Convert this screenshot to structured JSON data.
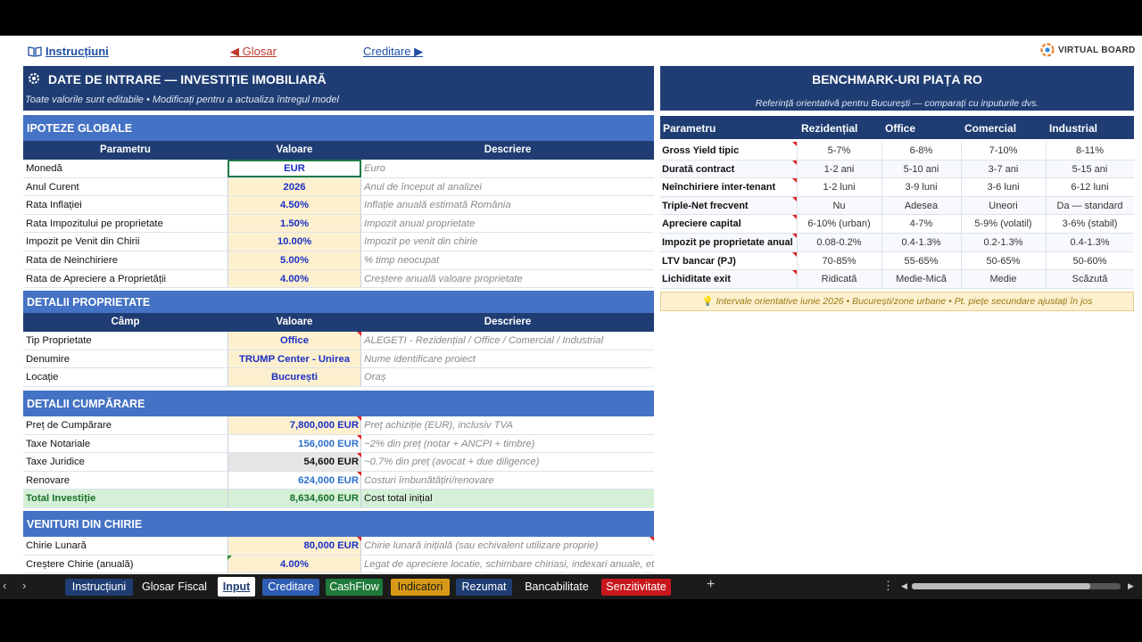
{
  "nav": {
    "instructions": "Instrucțiuni",
    "back": "◀ Glosar",
    "forward": "Creditare ▶",
    "logo": "VIRTUAL BOARD",
    "book_icon": "book-icon"
  },
  "input_header": {
    "title": "DATE DE INTRARE — INVESTIȚIE IMOBILIARĂ",
    "subtitle": "Toate valorile sunt editabile  •  Modificați pentru a actualiza întregul model",
    "icon": "gear-icon"
  },
  "benchmark_header": {
    "title": "BENCHMARK-URI PIAȚA RO",
    "subtitle": "Referință orientativă pentru București — comparați cu inputurile dvs."
  },
  "global": {
    "title": "IPOTEZE GLOBALE",
    "cols": [
      "Parametru",
      "Valoare",
      "Descriere"
    ],
    "rows": [
      {
        "label": "Monedă",
        "value": "EUR",
        "desc": "Euro"
      },
      {
        "label": "Anul Curent",
        "value": "2026",
        "desc": "Anul de început al analizei"
      },
      {
        "label": "Rata Inflației",
        "value": "4.50%",
        "desc": "Inflație anuală estimată România"
      },
      {
        "label": "Rata Impozitului pe proprietate",
        "value": "1.50%",
        "desc": "Impozit anual proprietate"
      },
      {
        "label": "Impozit pe Venit din Chirii",
        "value": "10.00%",
        "desc": "Impozit pe venit din chirie"
      },
      {
        "label": "Rata de Neinchiriere",
        "value": "5.00%",
        "desc": "% timp neocupat"
      },
      {
        "label": "Rata de Apreciere a Proprietății",
        "value": "4.00%",
        "desc": "Creștere anuală valoare proprietate"
      }
    ]
  },
  "property": {
    "title": "DETALII PROPRIETATE",
    "cols": [
      "Câmp",
      "Valoare",
      "Descriere"
    ],
    "rows": [
      {
        "label": "Tip Proprietate",
        "value": "Office",
        "desc": "ALEGETI - Rezidențial / Office / Comercial / Industrial"
      },
      {
        "label": "Denumire",
        "value": "TRUMP Center - Unirea",
        "desc": "Nume identificare proiect"
      },
      {
        "label": "Locație",
        "value": "București",
        "desc": "Oraș"
      }
    ]
  },
  "purchase": {
    "title": "DETALII CUMPĂRARE",
    "rows": [
      {
        "label": "Preț de Cumpărare",
        "value": "7,800,000 EUR",
        "desc": "Preț achiziție (EUR), inclusiv TVA"
      },
      {
        "label": "Taxe Notariale",
        "value": "156,000 EUR",
        "desc": "~2% din preț (notar + ANCPI + timbre)"
      },
      {
        "label": "Taxe Juridice",
        "value": "54,600 EUR",
        "desc": "~0.7% din preț (avocat + due diligence)"
      },
      {
        "label": "Renovare",
        "value": "624,000 EUR",
        "desc": "Costuri îmbunătățiri/renovare"
      }
    ],
    "total": {
      "label": "Total Investiție",
      "value": "8,634,600 EUR",
      "desc": "Cost total inițial"
    }
  },
  "rent": {
    "title": "VENITURI DIN CHIRIE",
    "rows": [
      {
        "label": "Chirie Lunară",
        "value": "80,000 EUR",
        "desc": "Chirie lunară inițială (sau echivalent utilizare proprie)"
      },
      {
        "label": "Creștere Chirie (anuală)",
        "value": "4.00%",
        "desc": "Legat de apreciere locatie, schimbare chiriasi, indexari anuale, etc"
      }
    ]
  },
  "benchmark": {
    "cols": [
      "Parametru",
      "Rezidențial",
      "Office",
      "Comercial",
      "Industrial"
    ],
    "rows": [
      [
        "Gross Yield tipic",
        "5-7%",
        "6-8%",
        "7-10%",
        "8-11%"
      ],
      [
        "Durată contract",
        "1-2 ani",
        "5-10 ani",
        "3-7 ani",
        "5-15 ani"
      ],
      [
        "Neînchiriere inter-tenant",
        "1-2 luni",
        "3-9 luni",
        "3-6 luni",
        "6-12 luni"
      ],
      [
        "Triple-Net frecvent",
        "Nu",
        "Adesea",
        "Uneori",
        "Da — standard"
      ],
      [
        "Apreciere capital",
        "6-10% (urban)",
        "4-7%",
        "5-9% (volatil)",
        "3-6% (stabil)"
      ],
      [
        "Impozit pe proprietate anual",
        "0.08-0.2%",
        "0.4-1.3%",
        "0.2-1.3%",
        "0.4-1.3%"
      ],
      [
        "LTV bancar (PJ)",
        "70-85%",
        "55-65%",
        "50-65%",
        "50-60%"
      ],
      [
        "Lichiditate exit",
        "Ridicată",
        "Medie-Mică",
        "Medie",
        "Scăzută"
      ]
    ],
    "note": "Intervale orientative iunie 2026 • București/zone urbane • Pt. piețe secundare ajustați în jos",
    "note_icon": "lightbulb-icon"
  },
  "tabs": [
    {
      "label": "Instrucțiuni",
      "bg": "#1f3d73",
      "color": "#ffffff"
    },
    {
      "label": "Glosar Fiscal",
      "bg": "#1b1b1b",
      "color": "#ffffff"
    },
    {
      "label": "Input",
      "bg": "#ffffff",
      "color": "#1f3d73"
    },
    {
      "label": "Creditare",
      "bg": "#2e5db3",
      "color": "#ffffff"
    },
    {
      "label": "CashFlow",
      "bg": "#1f7a3a",
      "color": "#ffffff"
    },
    {
      "label": "Indicatori",
      "bg": "#d89a16",
      "color": "#1b1b1b"
    },
    {
      "label": "Rezumat",
      "bg": "#1f3d73",
      "color": "#ffffff"
    },
    {
      "label": "Bancabilitate",
      "bg": "#1b1b1b",
      "color": "#ffffff"
    },
    {
      "label": "Senzitivitate",
      "bg": "#c8161d",
      "color": "#ffffff"
    }
  ],
  "tab_controls": {
    "add": "+",
    "more": "⋮",
    "prev": "‹",
    "next": "›",
    "scroll_left": "◀",
    "scroll_right": "▶"
  }
}
